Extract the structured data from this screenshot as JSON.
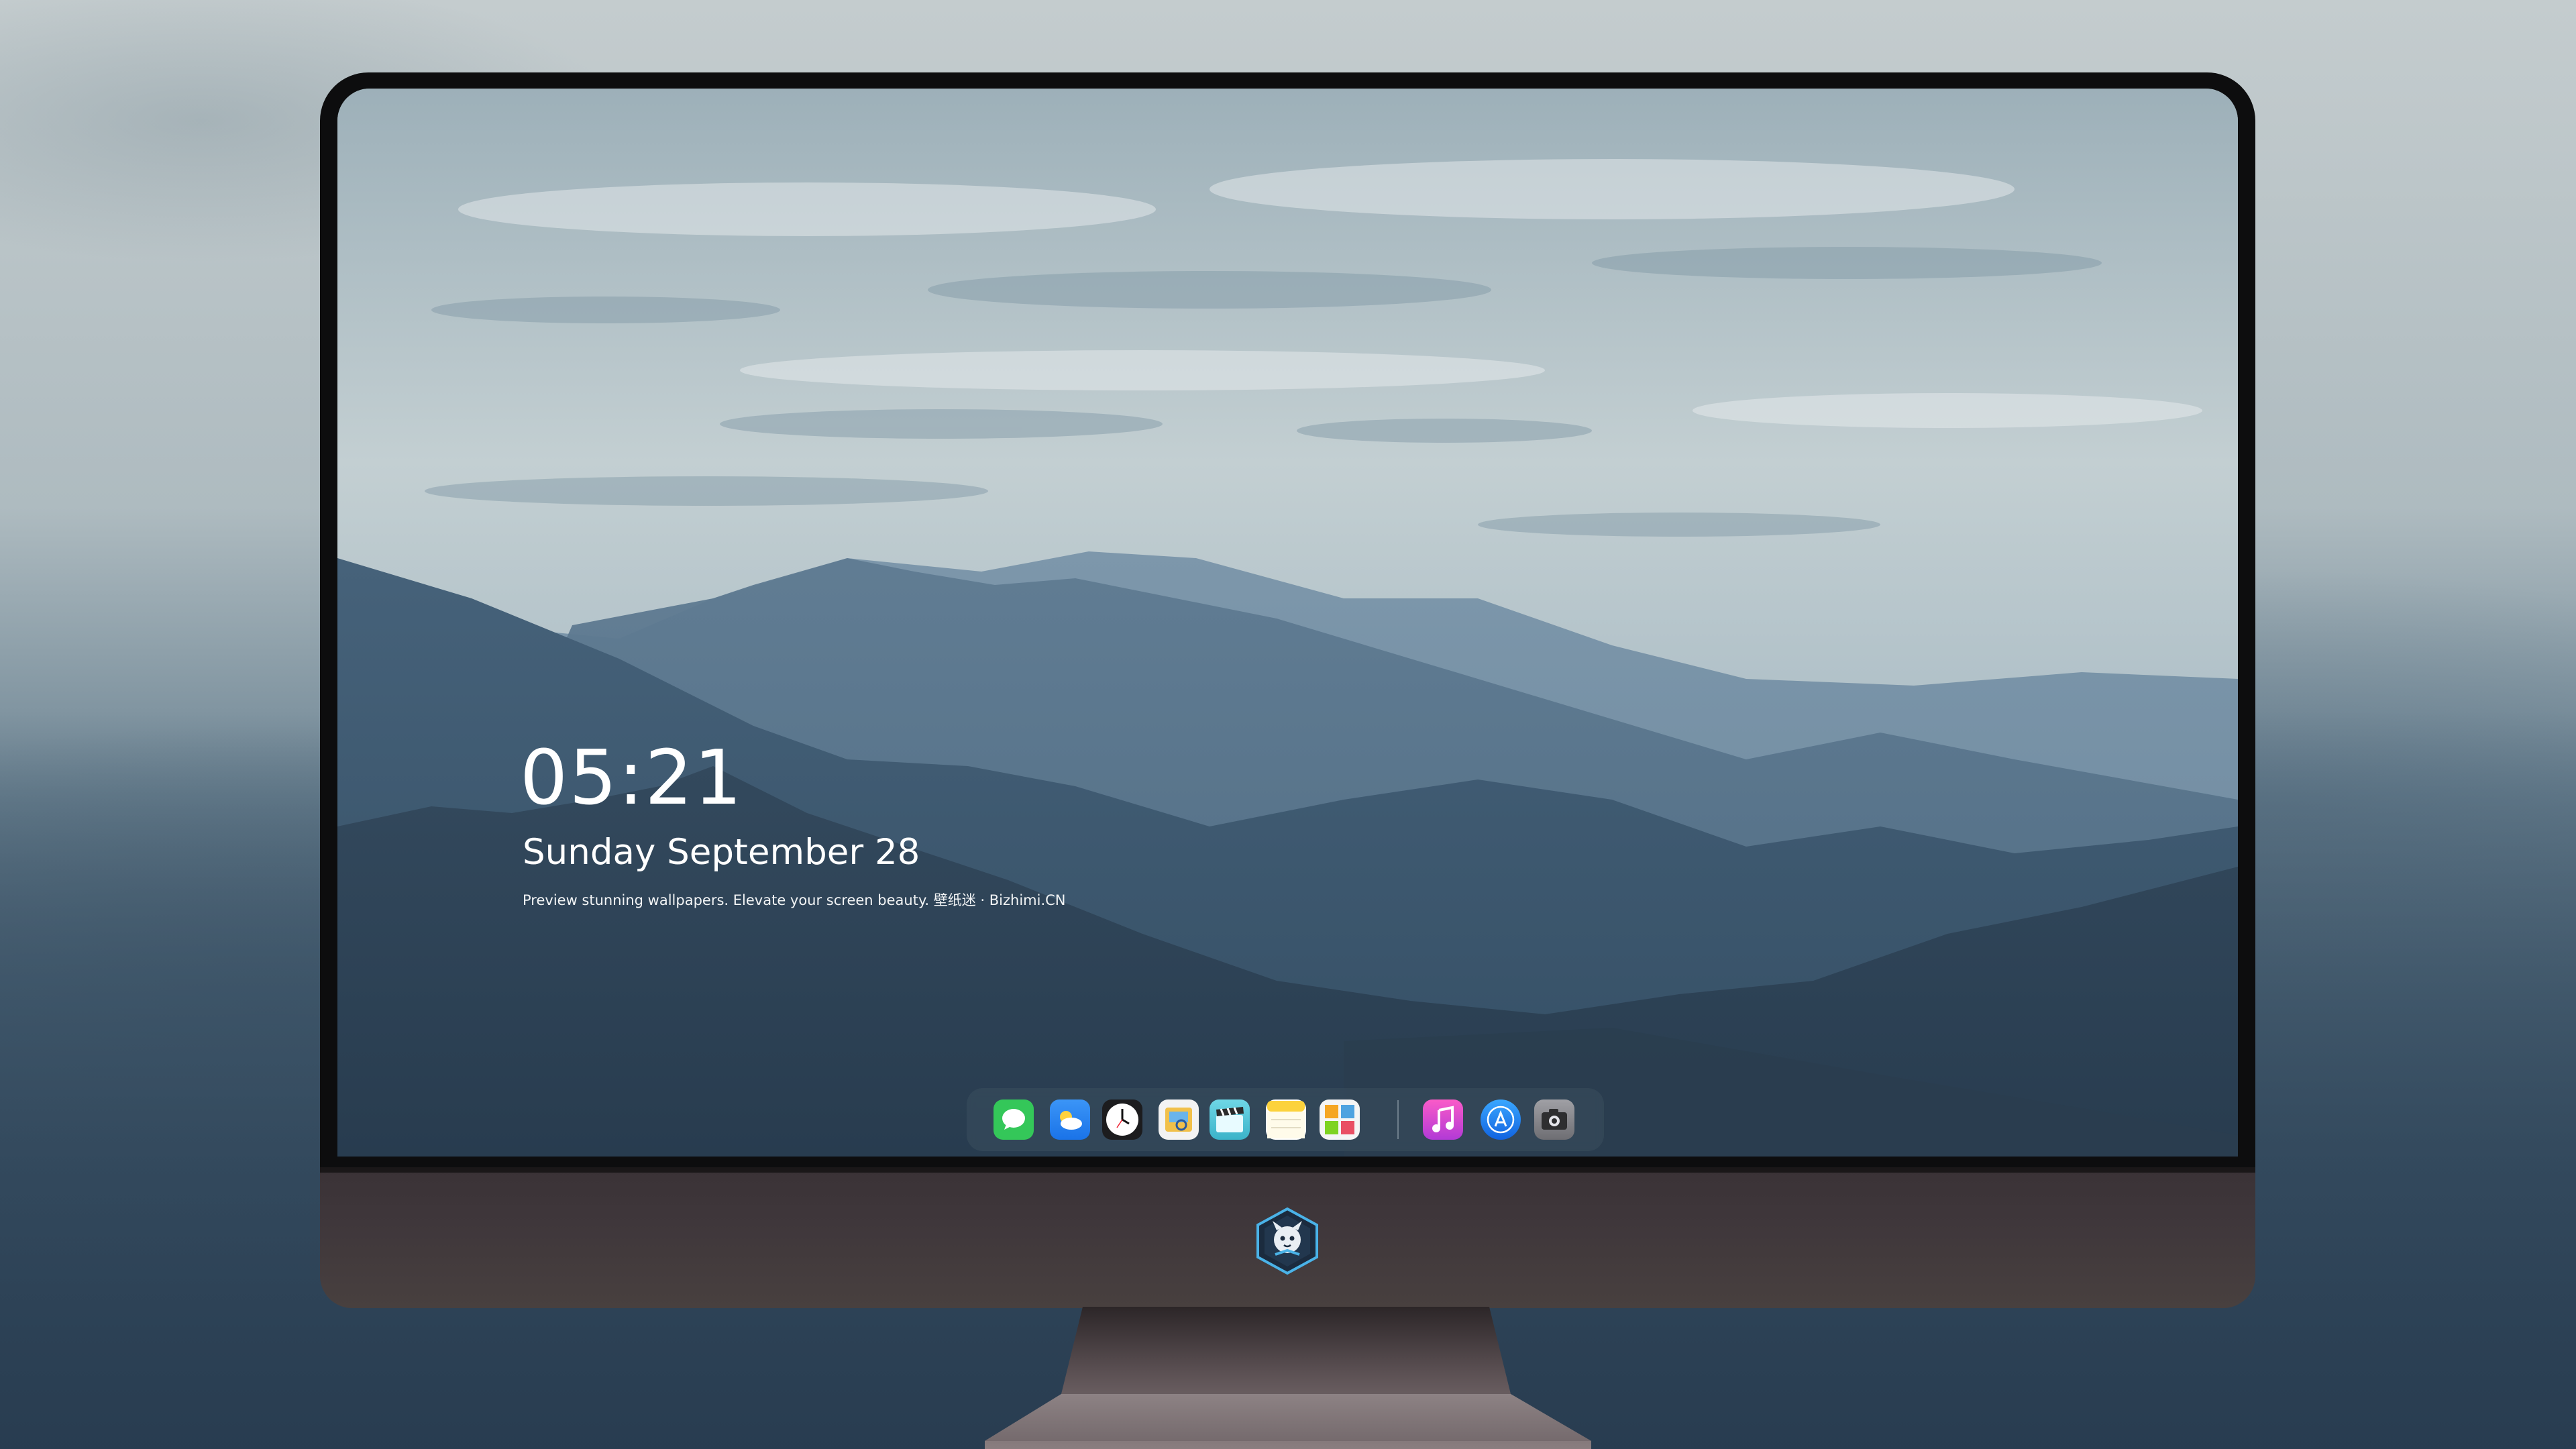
{
  "lockscreen": {
    "time": "05:21",
    "date": "Sunday September  28",
    "tagline": "Preview stunning wallpapers. Elevate your screen beauty. 壁纸迷 · Bizhimi.CN"
  },
  "dock": {
    "apps": [
      {
        "name": "Messages",
        "icon": "messages-icon",
        "color": "#34c759"
      },
      {
        "name": "Weather",
        "icon": "weather-icon",
        "color": "#2f8ef4"
      },
      {
        "name": "Clock",
        "icon": "clock-icon",
        "color": "#1c1c1e"
      },
      {
        "name": "Preview",
        "icon": "preview-icon",
        "color": "#f1c04a"
      },
      {
        "name": "Final Cut Pro",
        "icon": "clapperboard-icon",
        "color": "#58c9d9"
      },
      {
        "name": "Notes",
        "icon": "notes-icon",
        "color": "#fcd23c"
      },
      {
        "name": "Photo Booth",
        "icon": "gallery-icon",
        "color": "#4fa3e0"
      },
      {
        "name": "iTunes",
        "icon": "music-icon",
        "color": "#e93fb8"
      },
      {
        "name": "App Store",
        "icon": "app-store-icon",
        "color": "#1f8ef0"
      },
      {
        "name": "Screenshot",
        "icon": "camera-icon",
        "color": "#8e8e93"
      }
    ]
  },
  "colors": {
    "bezel": "#0d0d0e",
    "chin": "#3f373b",
    "text": "#ffffff"
  }
}
